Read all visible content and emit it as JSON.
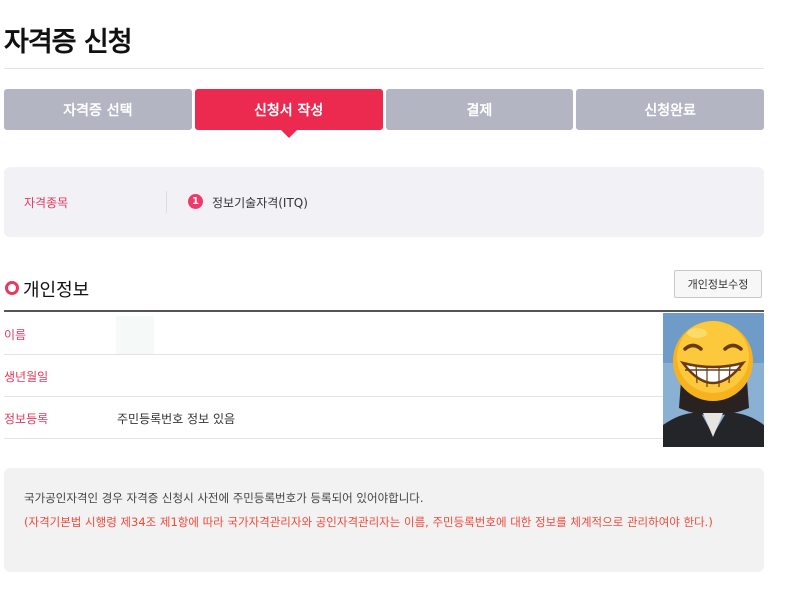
{
  "page": {
    "title": "자격증 신청"
  },
  "steps": [
    {
      "label": "자격증 선택",
      "active": false
    },
    {
      "label": "신청서 작성",
      "active": true
    },
    {
      "label": "결제",
      "active": false
    },
    {
      "label": "신청완료",
      "active": false
    }
  ],
  "certificate": {
    "label": "자격종목",
    "badge": "1",
    "value": "정보기술자격(ITQ)"
  },
  "personal_info": {
    "title": "개인정보",
    "edit_button": "개인정보수정",
    "rows": [
      {
        "label": "이름",
        "value": ""
      },
      {
        "label": "생년월일",
        "value": ""
      },
      {
        "label": "정보등록",
        "value": "주민등록번호 정보 있음"
      }
    ]
  },
  "notice": {
    "line1": "국가공인자격인 경우 자격증 신청시 사전에 주민등록번호가 등록되어 있어야합니다.",
    "line2": "(자격기본법 시행령 제34조 제1항에 따라 국가자격관리자와 공인자격관리자는 이름, 주민등록번호에 대한 정보를 체계적으로 관리하여야 한다.)"
  },
  "colors": {
    "accent": "#ec2a50",
    "step_inactive": "#b3b6c2",
    "label": "#e13b5e",
    "notice_warning": "#ef4b3b"
  }
}
